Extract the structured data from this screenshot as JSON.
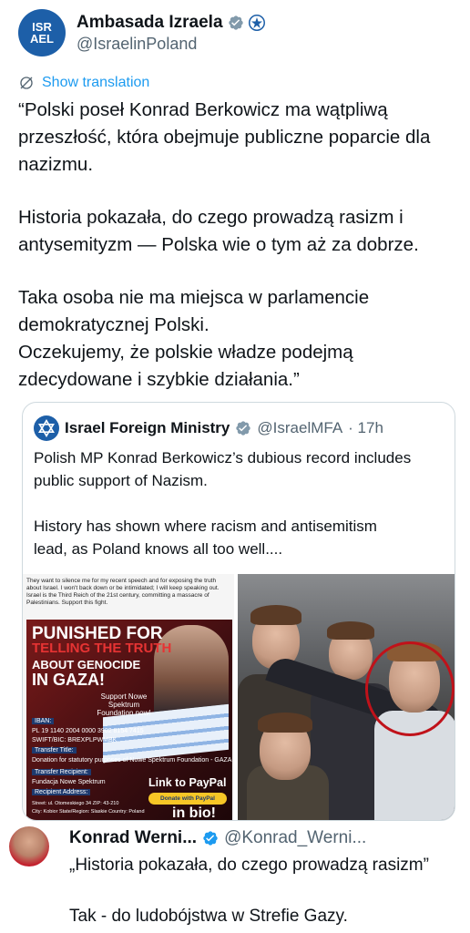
{
  "author": {
    "display_name": "Ambasada Izraela",
    "handle": "@IsraelinPoland",
    "avatar_text": "ISR\nAEL"
  },
  "translate_label": "Show translation",
  "tweet": {
    "paragraphs": [
      [
        "“Polski poseł Konrad Berkowicz ma wątpliwą",
        "przeszłość, która obejmuje publiczne poparcie dla",
        "nazizmu."
      ],
      [
        "Historia pokazała, do czego prowadzą rasizm i",
        "antysemityzm — Polska wie o tym aż za dobrze."
      ],
      [
        "Taka osoba nie ma miejsca w parlamencie",
        "demokratycznej Polski.",
        "Oczekujemy, że polskie władze podejmą",
        "zdecydowane i szybkie działania.”"
      ]
    ]
  },
  "quote": {
    "display_name": "Israel Foreign Ministry",
    "handle": "@IsraelMFA",
    "time": "· 17h",
    "text_lines": [
      "Polish MP Konrad Berkowicz’s dubious record includes",
      "public support of Nazism."
    ],
    "text_lines2": [
      "History has shown where racism and antisemitism",
      "lead, as Poland knows all too well...."
    ],
    "media": {
      "caption": "They want to silence me for my recent speech and for exposing the truth about Israel. I won't back down or be intimidated; I will keep speaking out. Israel is the Third Reich of the 21st century, committing a massacre of Palestinians. Support this fight.",
      "poster": {
        "line1": "PUNISHED FOR",
        "line2": "TELLING THE TRUTH",
        "line3": "ABOUT GENOCIDE",
        "line4": "IN GAZA!",
        "support": "Support Nowe Spektrum Foundation now!",
        "iban_label": "IBAN:",
        "iban": "PL 19 1140 2004 0000 3902 8154 7415",
        "swift": "SWIFT/BIC: BREXPLPWMBK",
        "transfer_title_label": "Transfer Title:",
        "transfer_title": "Donation for statutory purposes of Nowe Spektrum Foundation - GAZA",
        "recipient_label": "Transfer Recipient:",
        "recipient": "Fundacja Nowe Spektrum",
        "address_label": "Recipient Address:",
        "address": "Street: ul. Otomeskiego 34  ZIP: 43-210",
        "city": "City: Kobior State/Region: Slaskie Country: Poland",
        "paypal": "Link to PayPal",
        "donate": "Donate with PayPal",
        "inbio": "in bio!"
      }
    }
  },
  "reply": {
    "display_name": "Konrad Werni...",
    "handle": "@Konrad_Werni...",
    "line1": "„Historia pokazała, do czego prowadzą rasizm”",
    "line2": "Tak - do ludobójstwa w Strefie Gazy."
  },
  "colors": {
    "link": "#1d9bf0",
    "verified_blue": "#1d9bf0",
    "verified_grey": "#829aab",
    "secondary_text": "#536471",
    "red_circle": "#c0121a"
  }
}
